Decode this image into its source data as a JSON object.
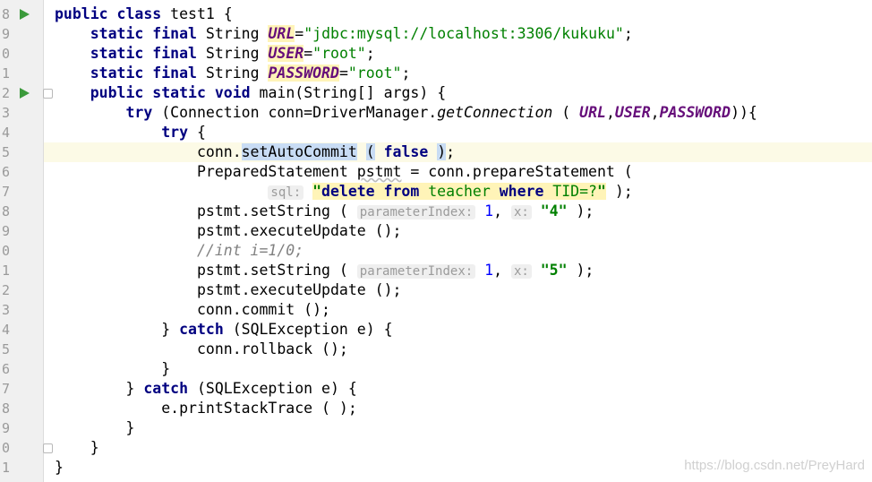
{
  "lines": [
    {
      "no": "8",
      "run": true
    },
    {
      "no": "9"
    },
    {
      "no": "0"
    },
    {
      "no": "1"
    },
    {
      "no": "2",
      "run": true,
      "fold": true
    },
    {
      "no": "3"
    },
    {
      "no": "4"
    },
    {
      "no": "5"
    },
    {
      "no": "6"
    },
    {
      "no": "7"
    },
    {
      "no": "8"
    },
    {
      "no": "9"
    },
    {
      "no": "0"
    },
    {
      "no": "1"
    },
    {
      "no": "2"
    },
    {
      "no": "3"
    },
    {
      "no": "4"
    },
    {
      "no": "5"
    },
    {
      "no": "6"
    },
    {
      "no": "7"
    },
    {
      "no": "8"
    },
    {
      "no": "9"
    },
    {
      "no": "0",
      "fold": true
    },
    {
      "no": "1"
    }
  ],
  "code": {
    "kw_public": "public",
    "kw_class": "class",
    "class_name": "test1",
    "lbrace": "{",
    "rbrace": "}",
    "kw_static": "static",
    "kw_final": "final",
    "type_string": "String",
    "fld_url": "URL",
    "fld_user": "USER",
    "fld_password": "PASSWORD",
    "eq": "=",
    "semi": ";",
    "str_url": "\"jdbc:mysql://localhost:3306/kukuku\"",
    "str_root": "\"root\"",
    "kw_void": "void",
    "main_sig": "main(String[] args)",
    "kw_try": "try",
    "conn_decl": "(Connection conn=DriverManager.",
    "get_connection": "getConnection",
    "open_paren": "(",
    "close_paren": ")",
    "comma": ",",
    "try_end": ")){",
    "conn_dot": "conn.",
    "set_auto_commit": "setAutoCommit",
    "kw_false": "false",
    "prep_line": "PreparedStatement ",
    "pstmt": "pstmt",
    "prep_rest": " = conn.prepareStatement (",
    "hint_sql": "sql:",
    "sql_q1": "\"",
    "sql_delete": "delete from",
    "sql_teacher": " teacher ",
    "sql_where": "where",
    "sql_tid": " TID=?",
    "sql_q2": "\"",
    "sql_end": " );",
    "set_string": "pstmt.setString ( ",
    "hint_param": "parameterIndex:",
    "one": "1",
    "hint_x": "x:",
    "str_4": "\"4\"",
    "str_5": "\"5\"",
    "close_stmt": " );",
    "execute_update": "pstmt.executeUpdate ();",
    "comment_line": "//int i=1/0;",
    "commit": "conn.commit ();",
    "kw_catch": "catch",
    "sql_exc": " (SQLException e) {",
    "rollback": "conn.rollback ();",
    "print_trace": "e.printStackTrace ( );"
  },
  "watermark": "https://blog.csdn.net/PreyHard"
}
